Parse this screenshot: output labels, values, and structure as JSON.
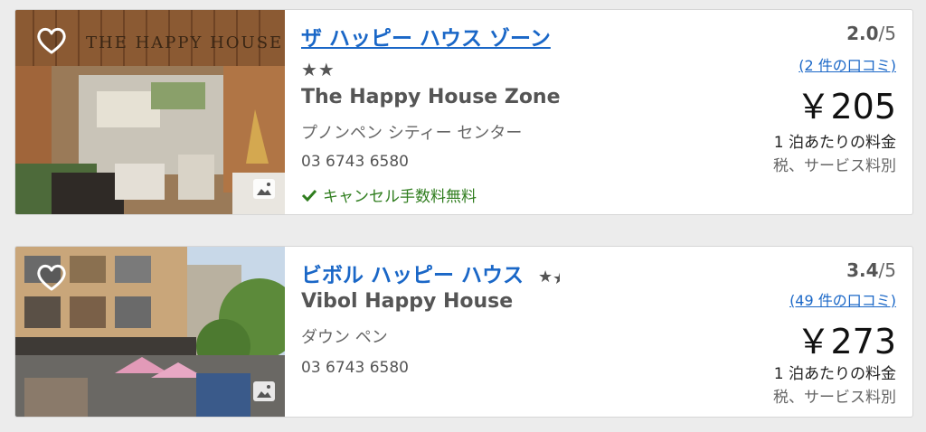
{
  "hotels": [
    {
      "name_jp": "ザ ハッピー ハウス ゾーン",
      "name_en": "The Happy House Zone",
      "stars": "★★",
      "area": "プノンペン シティー センター",
      "phone": "03 6743 6580",
      "cancellation": "キャンセル手数料無料",
      "rating_score": "2.0",
      "rating_max": "/5",
      "reviews": "(2 件の口コミ)",
      "price": "￥205",
      "price_note": "1 泊あたりの料金",
      "tax_note": "税、サービス料別",
      "photo_sign": "THE HAPPY HOUSE"
    },
    {
      "name_jp": "ビボル ハッピー ハウス",
      "name_en": "Vibol Happy House",
      "stars": "★",
      "area": "ダウン ペン",
      "phone": "03 6743 6580",
      "rating_score": "3.4",
      "rating_max": "/5",
      "reviews": "(49 件の口コミ)",
      "price": "￥273",
      "price_note": "1 泊あたりの料金",
      "tax_note": "税、サービス料別"
    }
  ],
  "colors": {
    "link": "#1a67c7",
    "cancel_green": "#2f7d1e"
  },
  "icons": [
    "heart-icon",
    "image-gallery-icon",
    "checkmark-icon",
    "star-icon",
    "half-star-icon"
  ]
}
